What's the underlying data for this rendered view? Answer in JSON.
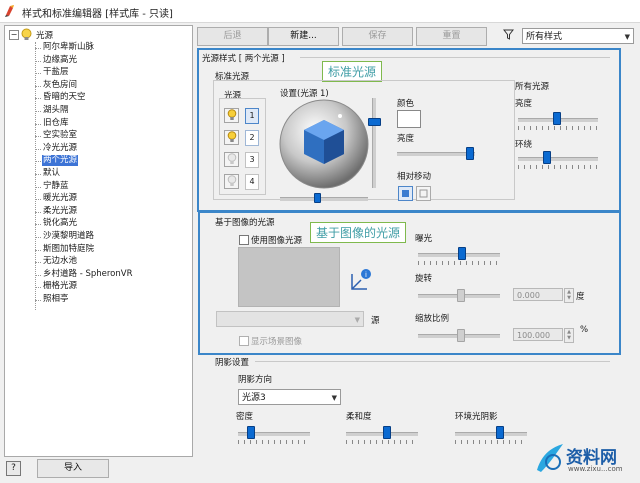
{
  "window": {
    "title": "样式和标准编辑器 [样式库 - 只读]"
  },
  "tree": {
    "root": "光源",
    "items": [
      {
        "label": "阿尔卑斯山脉"
      },
      {
        "label": "边缘高光"
      },
      {
        "label": "干盐层"
      },
      {
        "label": "灰色房间"
      },
      {
        "label": "昏暗的天空"
      },
      {
        "label": "湖头隔"
      },
      {
        "label": "旧仓库"
      },
      {
        "label": "空实验室"
      },
      {
        "label": "冷光光源"
      },
      {
        "label": "两个光源",
        "selected": true
      },
      {
        "label": "默认"
      },
      {
        "label": "宁静蓝"
      },
      {
        "label": "暖光光源"
      },
      {
        "label": "柔光光源"
      },
      {
        "label": "锐化高光"
      },
      {
        "label": "沙漠黎明道路"
      },
      {
        "label": "斯图加特庭院"
      },
      {
        "label": "无边水池"
      },
      {
        "label": "乡村道路 - SpheronVR"
      },
      {
        "label": "栅格光源"
      },
      {
        "label": "照相亭"
      }
    ]
  },
  "toolbar": {
    "back": "后退",
    "new": "新建...",
    "save": "保存",
    "reset": "重置",
    "filter_value": "所有样式"
  },
  "light_style": {
    "header": "光源样式 [ 两个光源 ]",
    "standard_light": "标准光源",
    "lights_label": "光源",
    "light_numbers": [
      "1",
      "2",
      "3",
      "4"
    ],
    "settings_label": "设置(光源 1)",
    "color_label": "颜色",
    "brightness_label": "亮度",
    "relative_move_label": "相对移动",
    "all_lights_label": "所有光源",
    "all_brightness_label": "亮度",
    "ambient_label": "环绕"
  },
  "ibl": {
    "header": "基于图像的光源",
    "use_ibl": "使用图像光源",
    "source_label": "源",
    "show_scene_image": "显示场景图像",
    "exposure_label": "曝光",
    "rotation_label": "旋转",
    "rotation_value": "0.000",
    "rotation_unit": "度",
    "scale_label": "缩放比例",
    "scale_value": "100.000",
    "scale_unit": "%"
  },
  "shadow": {
    "header": "阴影设置",
    "direction_label": "阴影方向",
    "direction_value": "光源3",
    "density_label": "密度",
    "softness_label": "柔和度",
    "ambient_shadow_label": "环境光阴影"
  },
  "footer": {
    "import_label": "导入",
    "help_glyph": "?"
  },
  "callouts": {
    "standard": "标准光源",
    "ibl": "基于图像的光源"
  },
  "watermark": {
    "text": "资料网",
    "url": "www.zixu...com"
  }
}
